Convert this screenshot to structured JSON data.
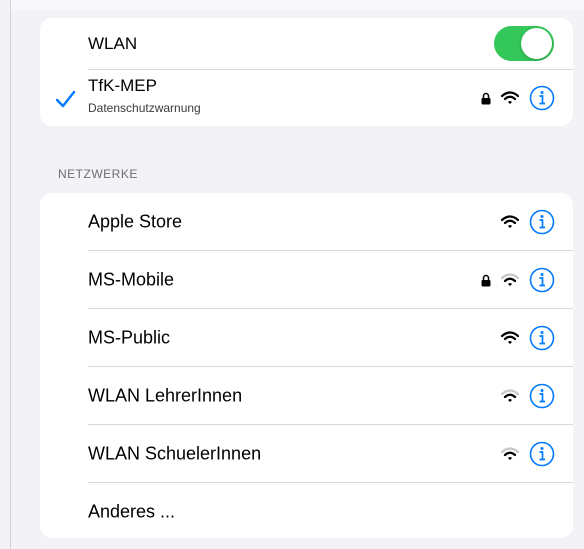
{
  "colors": {
    "accent": "#007aff",
    "toggle_on": "#34c759",
    "background": "#f2f2f7"
  },
  "wlan": {
    "label": "WLAN",
    "enabled": true
  },
  "current_network": {
    "name": "TfK-MEP",
    "subtitle": "Datenschutzwarnung",
    "connected": true,
    "secured": true,
    "icons": [
      "checkmark-icon",
      "lock-icon",
      "wifi-icon",
      "info-icon"
    ]
  },
  "networks_section": {
    "header": "NETZWERKE",
    "items": [
      {
        "name": "Apple Store",
        "secured": false,
        "signal": "full"
      },
      {
        "name": "MS-Mobile",
        "secured": true,
        "signal": "weak"
      },
      {
        "name": "MS-Public",
        "secured": false,
        "signal": "full"
      },
      {
        "name": "WLAN LehrerInnen",
        "secured": false,
        "signal": "weak"
      },
      {
        "name": "WLAN SchuelerInnen",
        "secured": false,
        "signal": "weak"
      }
    ],
    "other_label": "Anderes ..."
  }
}
